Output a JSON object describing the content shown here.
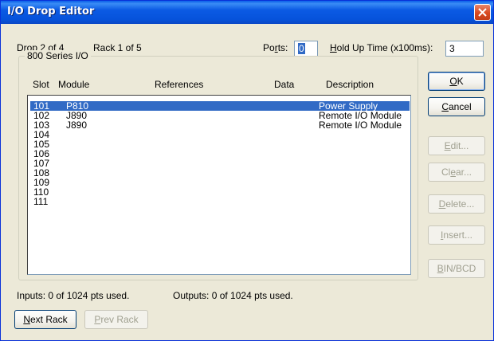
{
  "window": {
    "title": "I/O Drop Editor"
  },
  "header": {
    "drop_label": "Drop 2 of 4",
    "rack_label": "Rack 1 of 5",
    "ports_label_pre": "Po",
    "ports_label_u": "r",
    "ports_label_post": "ts:",
    "ports_value": "0",
    "hold_label_u": "H",
    "hold_label_post": "old Up Time (x100ms):",
    "hold_value": "3"
  },
  "group": {
    "title": "800 Series I/O",
    "columns": {
      "slot": "Slot",
      "module": "Module",
      "references": "References",
      "data": "Data",
      "description": "Description"
    },
    "rows": [
      {
        "slot": "101",
        "module": "P810",
        "description": "Power Supply",
        "selected": true
      },
      {
        "slot": "102",
        "module": "J890",
        "description": "Remote I/O Module"
      },
      {
        "slot": "103",
        "module": "J890",
        "description": "Remote I/O Module"
      },
      {
        "slot": "104",
        "module": "",
        "description": ""
      },
      {
        "slot": "105",
        "module": "",
        "description": ""
      },
      {
        "slot": "106",
        "module": "",
        "description": ""
      },
      {
        "slot": "107",
        "module": "",
        "description": ""
      },
      {
        "slot": "108",
        "module": "",
        "description": ""
      },
      {
        "slot": "109",
        "module": "",
        "description": ""
      },
      {
        "slot": "110",
        "module": "",
        "description": ""
      },
      {
        "slot": "111",
        "module": "",
        "description": ""
      }
    ]
  },
  "buttons": {
    "ok_u": "O",
    "ok_post": "K",
    "cancel_u": "C",
    "cancel_post": "ancel",
    "edit_u": "E",
    "edit_post": "dit...",
    "clear_pre": "Cl",
    "clear_u": "e",
    "clear_post": "ar...",
    "delete_u": "D",
    "delete_post": "elete...",
    "insert_u": "I",
    "insert_post": "nsert...",
    "binbcd_u": "B",
    "binbcd_post": "IN/BCD",
    "next_u": "N",
    "next_post": "ext Rack",
    "prev_u": "P",
    "prev_post": "rev Rack"
  },
  "status": {
    "inputs": "Inputs:  0 of 1024 pts used.",
    "outputs": "Outputs:  0 of 1024 pts used."
  }
}
